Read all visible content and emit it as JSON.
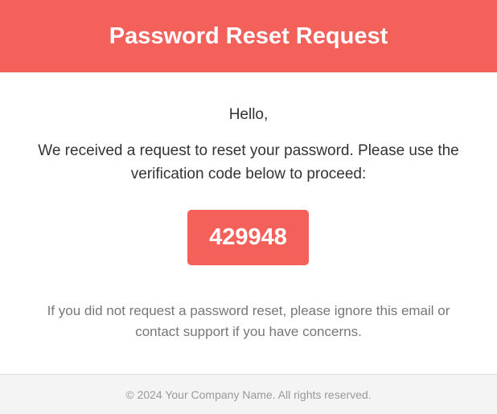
{
  "colors": {
    "accent": "#f4605a",
    "footer_background": "#f4f4f4",
    "body_text": "#333333",
    "muted_text": "#777777"
  },
  "header": {
    "title": "Password Reset Request"
  },
  "body": {
    "greeting": "Hello,",
    "message": "We received a request to reset your password. Please use the verification code below to proceed:",
    "verification_code": "429948",
    "note": "If you did not request a password reset, please ignore this email or contact support if you have concerns."
  },
  "footer": {
    "copyright": "© 2024 Your Company Name. All rights reserved."
  }
}
